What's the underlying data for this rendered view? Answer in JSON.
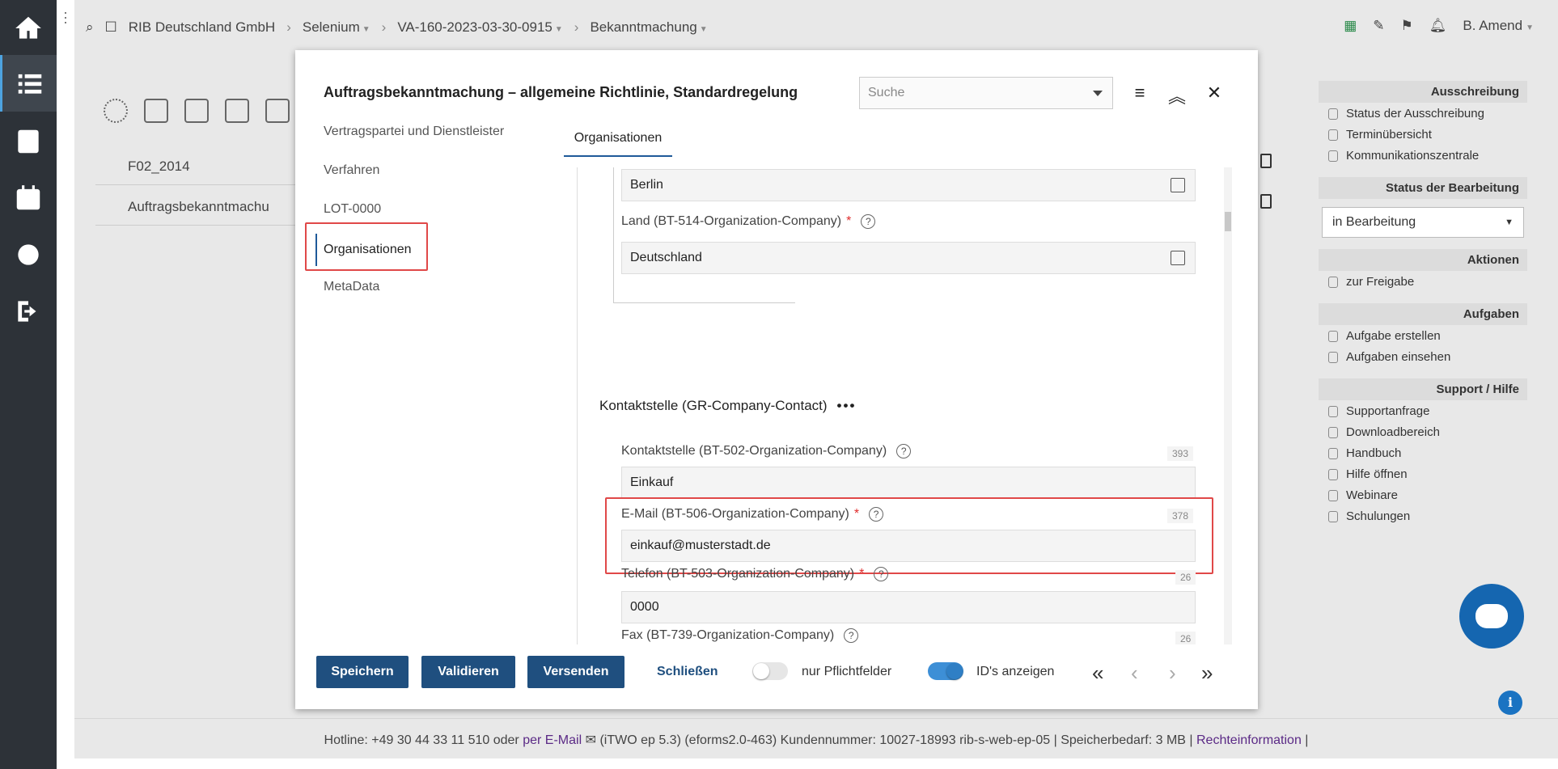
{
  "topbar": {
    "company": "RIB Deutschland GmbH",
    "project": "Selenium",
    "procedure": "VA-160-2023-03-30-0915",
    "section": "Bekanntmachung",
    "user": "B. Amend"
  },
  "background": {
    "rows": [
      {
        "label": "F02_2014"
      },
      {
        "label": "Auftragsbekanntmachu"
      }
    ]
  },
  "right_panel": {
    "ausschreibung": {
      "heading": "Ausschreibung",
      "links": [
        "Status der Ausschreibung",
        "Terminübersicht",
        "Kommunikationszentrale"
      ]
    },
    "status": {
      "heading": "Status der Bearbeitung",
      "value": "in Bearbeitung"
    },
    "aktionen": {
      "heading": "Aktionen",
      "links": [
        "zur Freigabe"
      ]
    },
    "aufgaben": {
      "heading": "Aufgaben",
      "links": [
        "Aufgabe erstellen",
        "Aufgaben einsehen"
      ]
    },
    "support": {
      "heading": "Support / Hilfe",
      "links": [
        "Supportanfrage",
        "Downloadbereich",
        "Handbuch",
        "Hilfe öffnen",
        "Webinare",
        "Schulungen"
      ]
    }
  },
  "dialog": {
    "title": "Auftragsbekanntmachung – allgemeine Richtlinie, Standardregelung",
    "search_placeholder": "Suche",
    "nav": [
      "Vertragspartei und Dienstleister",
      "Verfahren",
      "LOT-0000",
      "Organisationen",
      "MetaData"
    ],
    "tab": "Organisationen",
    "fields": {
      "city_value": "Berlin",
      "land_label": "Land (BT-514-Organization-Company)",
      "land_value": "Deutschland",
      "group_title": "Kontaktstelle (GR-Company-Contact)",
      "group_dots": "•••",
      "contact_label": "Kontaktstelle (BT-502-Organization-Company)",
      "contact_value": "Einkauf",
      "contact_counter": "393",
      "email_label": "E-Mail (BT-506-Organization-Company)",
      "email_value": "einkauf@musterstadt.de",
      "email_counter": "378",
      "phone_label": "Telefon (BT-503-Organization-Company)",
      "phone_value": "0000",
      "phone_counter": "26",
      "fax_label": "Fax (BT-739-Organization-Company)",
      "fax_counter": "26",
      "required_mark": "*",
      "help_mark": "?"
    },
    "footer": {
      "save": "Speichern",
      "validate": "Validieren",
      "send": "Versenden",
      "close": "Schließen",
      "only_required": "nur Pflichtfelder",
      "show_ids": "ID's anzeigen"
    }
  },
  "footer": {
    "hotline": "Hotline: +49 30 44 33 11 510 oder",
    "email_link": "per E-Mail",
    "info": "(iTWO ep 5.3) (eforms2.0-463)   Kundennummer: 10027-18993 rib-s-web-ep-05 | Speicherbedarf: 3 MB |",
    "legal_link": "Rechteinformation",
    "tail": "|"
  },
  "colors": {
    "primary": "#1f4f7f",
    "highlight": "#e04848",
    "sidebar": "#2d3238",
    "toggle_on": "#3d8fd6"
  }
}
